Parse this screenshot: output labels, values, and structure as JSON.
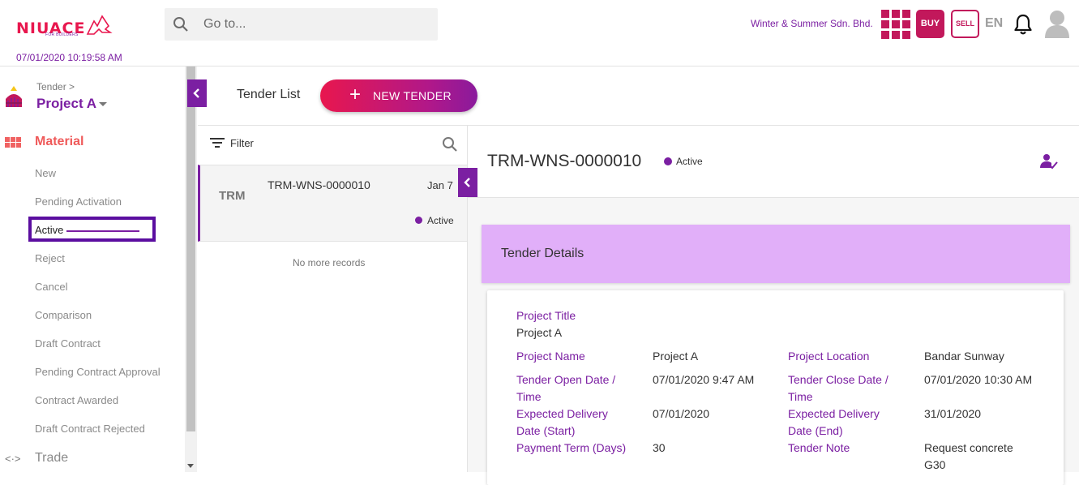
{
  "header": {
    "logo_text": "NIUACE",
    "logo_sub": "FOR BUILDERS",
    "search_placeholder": "Go to...",
    "company": "Winter & Summer Sdn. Bhd.",
    "buy_label": "BUY",
    "sell_label": "SELL",
    "language": "EN",
    "datetime": "07/01/2020 10:19:58 AM"
  },
  "sidebar": {
    "breadcrumb": "Tender >",
    "project": "Project A",
    "section_title": "Material",
    "items": [
      {
        "label": "New"
      },
      {
        "label": "Pending Activation"
      },
      {
        "label": "Active"
      },
      {
        "label": "Reject"
      },
      {
        "label": "Cancel"
      },
      {
        "label": "Comparison"
      },
      {
        "label": "Draft Contract"
      },
      {
        "label": "Pending Contract Approval"
      },
      {
        "label": "Contract Awarded"
      },
      {
        "label": "Draft Contract Rejected"
      }
    ],
    "trade_label": "Trade"
  },
  "toolbar": {
    "title": "Tender List",
    "new_button_label": "NEW TENDER"
  },
  "list": {
    "filter_label": "Filter",
    "rows": [
      {
        "abbr": "TRM",
        "code": "TRM-WNS-0000010",
        "date": "Jan 7",
        "status": "Active"
      }
    ],
    "no_more": "No more records"
  },
  "detail": {
    "title": "TRM-WNS-0000010",
    "status": "Active",
    "section_title": "Tender Details",
    "project_title_label": "Project Title",
    "project_title_value": "Project A",
    "project_name_label": "Project Name",
    "project_name_value": "Project A",
    "project_location_label": "Project Location",
    "project_location_value": "Bandar Sunway",
    "open_date_label_1": "Tender Open Date /",
    "open_date_label_2": "Time",
    "open_date_value": "07/01/2020 9:47 AM",
    "close_date_label_1": "Tender Close Date /",
    "close_date_label_2": "Time",
    "close_date_value": "07/01/2020 10:30 AM",
    "delivery_start_label_1": "Expected Delivery",
    "delivery_start_label_2": "Date (Start)",
    "delivery_start_value": "07/01/2020",
    "delivery_end_label_1": "Expected Delivery",
    "delivery_end_label_2": "Date (End)",
    "delivery_end_value": "31/01/2020",
    "payment_term_label": "Payment Term (Days)",
    "payment_term_value": "30",
    "tender_note_label": "Tender Note",
    "tender_note_value_1": "Request concrete",
    "tender_note_value_2": "G30"
  },
  "colors": {
    "brand_purple": "#7b1fa2",
    "brand_pink": "#e8174e",
    "accent_magenta": "#c2185b",
    "details_header_bg": "#e1aff9",
    "material_red": "#ef5a5a"
  }
}
